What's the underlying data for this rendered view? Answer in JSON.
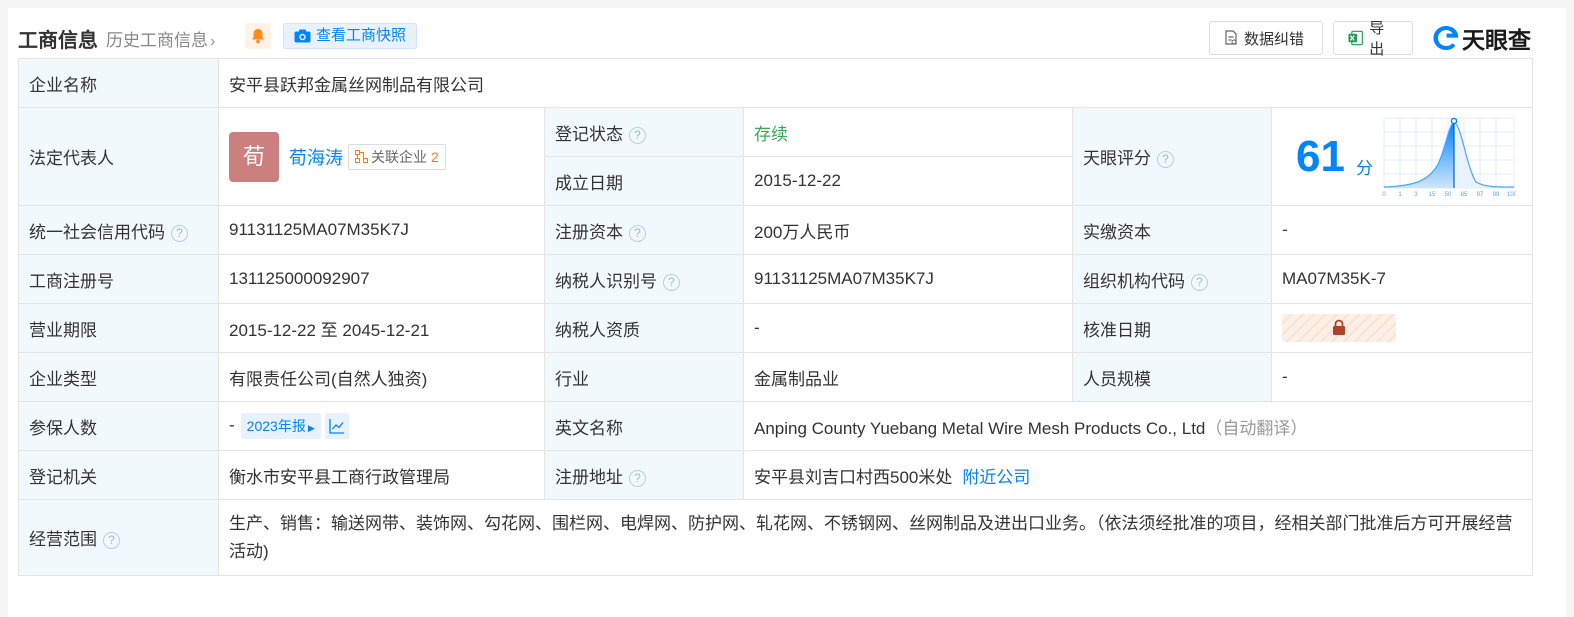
{
  "header": {
    "title": "工商信息",
    "history_link": "历史工商信息",
    "snapshot_button": "查看工商快照",
    "correct_button": "数据纠错",
    "export_button": "导出",
    "logo_text": "天眼查"
  },
  "labels": {
    "company_name": "企业名称",
    "legal_rep": "法定代表人",
    "reg_status": "登记状态",
    "found_date": "成立日期",
    "tianyan_score": "天眼评分",
    "credit_code": "统一社会信用代码",
    "reg_capital": "注册资本",
    "paid_capital": "实缴资本",
    "reg_number": "工商注册号",
    "taxpayer_id": "纳税人识别号",
    "org_code": "组织机构代码",
    "term": "营业期限",
    "taxpayer_quality": "纳税人资质",
    "approve_date": "核准日期",
    "company_type": "企业类型",
    "industry": "行业",
    "staff_size": "人员规模",
    "insured": "参保人数",
    "english_name": "英文名称",
    "reg_authority": "登记机关",
    "reg_address": "注册地址",
    "scope": "经营范围"
  },
  "values": {
    "company_name": "安平县跃邦金属丝网制品有限公司",
    "legal_avatar": "荀",
    "legal_name": "荀海涛",
    "related_label": "关联企业",
    "related_count": "2",
    "reg_status": "存续",
    "found_date": "2015-12-22",
    "score": "61",
    "score_unit": "分",
    "credit_code": "91131125MA07M35K7J",
    "reg_capital": "200万人民币",
    "paid_capital": "-",
    "reg_number": "131125000092907",
    "taxpayer_id": "91131125MA07M35K7J",
    "org_code": "MA07M35K-7",
    "term": "2015-12-22 至 2045-12-21",
    "taxpayer_quality": "-",
    "company_type": "有限责任公司(自然人独资)",
    "industry": "金属制品业",
    "staff_size": "-",
    "insured": "-",
    "insured_year_tag": "2023年报",
    "english_name": "Anping County Yuebang Metal Wire Mesh Products Co., Ltd",
    "auto_translate": "（自动翻译）",
    "reg_authority": "衡水市安平县工商行政管理局",
    "reg_address": "安平县刘吉口村西500米处",
    "nearby": "附近公司",
    "scope": "生产、销售：输送网带、装饰网、勾花网、围栏网、电焊网、防护网、轧花网、不锈钢网、丝网制品及进出口业务。（依法须经批准的项目，经相关部门批准后方可开展经营活动)"
  },
  "score_axis": [
    "0",
    "1",
    "3",
    "15",
    "50",
    "85",
    "97",
    "99",
    "100"
  ],
  "score_marker_position": 0.61,
  "colors": {
    "accent": "#0084ff",
    "status_green": "#3aa85c",
    "label_bg": "#f2f9fc",
    "avatar": "#cc7f7f"
  }
}
